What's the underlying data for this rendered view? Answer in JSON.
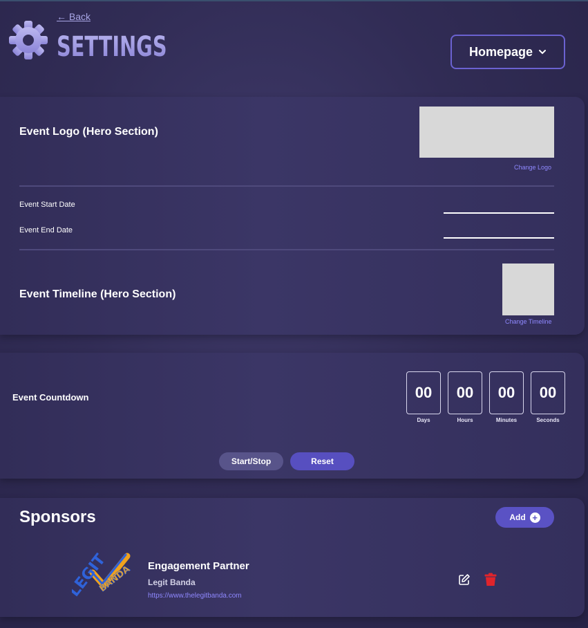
{
  "header": {
    "back_label": "← Back",
    "title": "SETTINGS",
    "page_select": "Homepage"
  },
  "hero": {
    "logo_heading": "Event Logo (Hero Section)",
    "change_logo": "Change Logo",
    "start_date_label": "Event Start Date",
    "end_date_label": "Event End Date",
    "timeline_heading": "Event Timeline (Hero Section)",
    "change_timeline": "Change Timeline"
  },
  "countdown": {
    "label": "Event Countdown",
    "units": [
      {
        "value": "00",
        "caption": "Days"
      },
      {
        "value": "00",
        "caption": "Hours"
      },
      {
        "value": "00",
        "caption": "Minutes"
      },
      {
        "value": "00",
        "caption": "Seconds"
      }
    ],
    "start_stop_label": "Start/Stop",
    "reset_label": "Reset"
  },
  "sponsors": {
    "title": "Sponsors",
    "add_label": "Add",
    "items": [
      {
        "role": "Engagement Partner",
        "name": "Legit Banda",
        "url": "https://www.thelegitbanda.com",
        "logo_text_left": "LEGIT",
        "logo_text_right": "BANDA"
      }
    ]
  },
  "colors": {
    "accent": "#5a52c4",
    "link": "#8f88ff",
    "delete": "#e0242b",
    "logo_blue": "#2f62d9",
    "logo_orange": "#f0a21e"
  }
}
